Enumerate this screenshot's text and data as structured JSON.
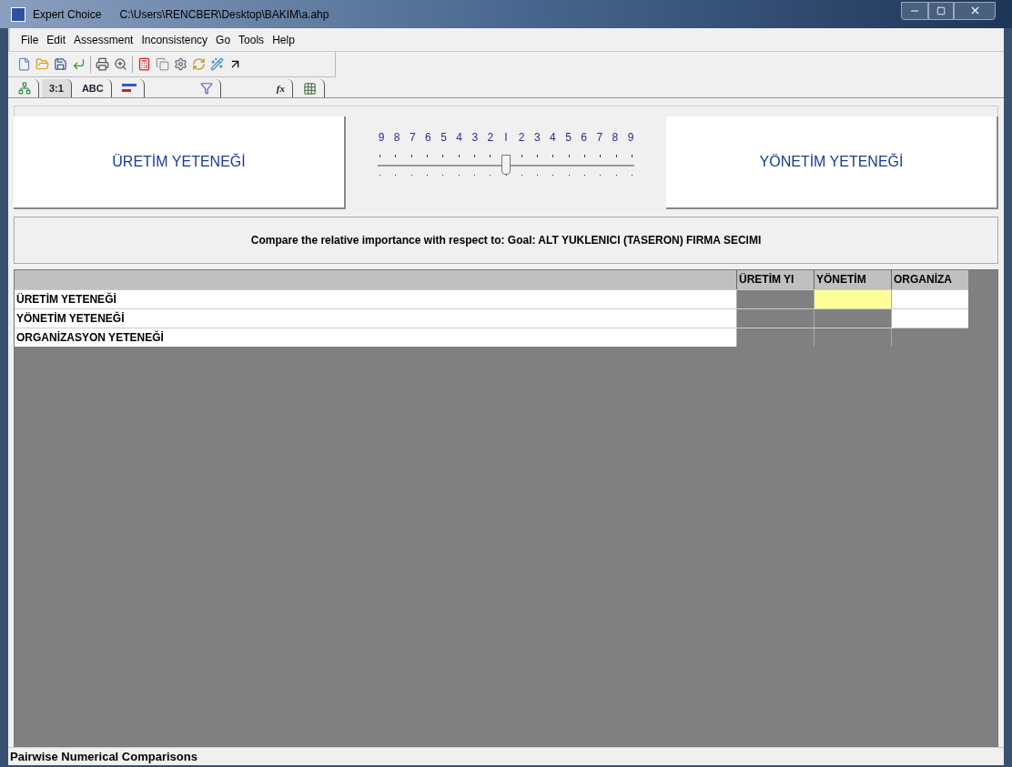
{
  "window": {
    "title": "Expert Choice",
    "path": "C:\\Users\\RENCBER\\Desktop\\BAKIM\\a.ahp"
  },
  "menu": [
    "File",
    "Edit",
    "Assessment",
    "Inconsistency",
    "Go",
    "Tools",
    "Help"
  ],
  "tabs": [
    {
      "kind": "icon",
      "selected": false
    },
    {
      "kind": "text",
      "label": "3:1",
      "selected": true
    },
    {
      "kind": "text",
      "label": "ABC",
      "selected": false
    },
    {
      "kind": "icon",
      "selected": false
    },
    {
      "kind": "icon",
      "selected": false
    },
    {
      "kind": "text",
      "label": "fx",
      "selected": false
    },
    {
      "kind": "icon",
      "selected": false
    }
  ],
  "comparison": {
    "left": "ÜRETİM YETENEĞİ",
    "right": "YÖNETİM YETENEĞİ",
    "scale": [
      "9",
      "8",
      "7",
      "6",
      "5",
      "4",
      "3",
      "2",
      "I",
      "2",
      "3",
      "4",
      "5",
      "6",
      "7",
      "8",
      "9"
    ],
    "slider": {
      "level": 0.5
    }
  },
  "prompt": "Compare the relative importance with respect to: Goal: ALT YUKLENICI (TASERON) FIRMA SECIMI",
  "matrix": {
    "columns": [
      "ÜRETİM YI",
      "YÖNETİM",
      "ORGANİZA"
    ],
    "rows": [
      {
        "label": "ÜRETİM YETENEĞİ",
        "cells": [
          {
            "kind": "shaded",
            "selected": false
          },
          {
            "kind": "open",
            "selected": true
          },
          {
            "kind": "open",
            "selected": false
          }
        ]
      },
      {
        "label": "YÖNETİM YETENEĞİ",
        "cells": [
          {
            "kind": "shaded",
            "selected": false
          },
          {
            "kind": "shaded",
            "selected": false
          },
          {
            "kind": "open",
            "selected": false
          }
        ]
      },
      {
        "label": "ORGANİZASYON YETENEĞİ",
        "cells": [
          {
            "kind": "shaded",
            "selected": false
          },
          {
            "kind": "shaded",
            "selected": false
          },
          {
            "kind": "shaded",
            "selected": false
          }
        ]
      }
    ]
  },
  "status_bar": "Pairwise Numerical Comparisons"
}
